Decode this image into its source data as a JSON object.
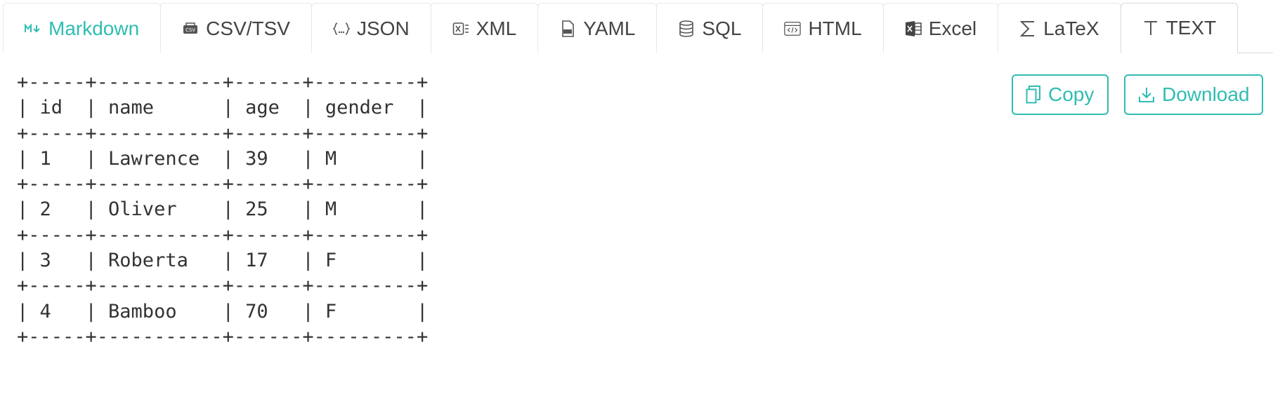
{
  "tabs": [
    {
      "label": "Markdown",
      "icon": "markdown-icon"
    },
    {
      "label": "CSV/TSV",
      "icon": "csv-icon"
    },
    {
      "label": "JSON",
      "icon": "json-icon"
    },
    {
      "label": "XML",
      "icon": "xml-icon"
    },
    {
      "label": "YAML",
      "icon": "yaml-icon"
    },
    {
      "label": "SQL",
      "icon": "database-icon"
    },
    {
      "label": "HTML",
      "icon": "html-icon"
    },
    {
      "label": "Excel",
      "icon": "excel-icon"
    },
    {
      "label": "LaTeX",
      "icon": "sigma-icon"
    },
    {
      "label": "TEXT",
      "icon": "text-icon"
    }
  ],
  "active_tab": "TEXT",
  "accent_color": "#2fbdb3",
  "actions": {
    "copy_label": "Copy",
    "download_label": "Download"
  },
  "table": {
    "columns": [
      "id",
      "name",
      "age",
      "gender"
    ],
    "rows": [
      [
        "1",
        "Lawrence",
        "39",
        "M"
      ],
      [
        "2",
        "Oliver",
        "25",
        "M"
      ],
      [
        "3",
        "Roberta",
        "17",
        "F"
      ],
      [
        "4",
        "Bamboo",
        "70",
        "F"
      ]
    ]
  }
}
